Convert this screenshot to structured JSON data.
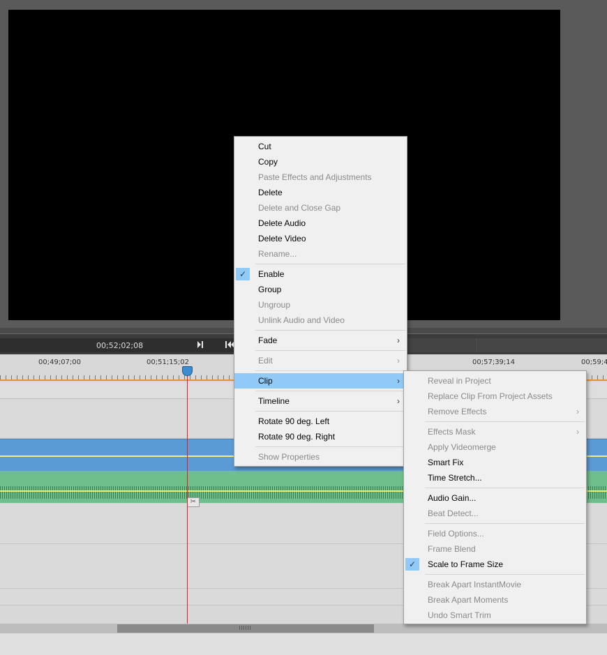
{
  "transport": {
    "timecode": "00;52;02;08"
  },
  "ruler": {
    "labels": [
      "00;49;07;00",
      "00;51;15;02",
      "00;57;39;14",
      "00;59;4"
    ]
  },
  "context_menu": {
    "items": [
      {
        "label": "Cut",
        "enabled": true
      },
      {
        "label": "Copy",
        "enabled": true
      },
      {
        "label": "Paste Effects and Adjustments",
        "enabled": false
      },
      {
        "label": "Delete",
        "enabled": true
      },
      {
        "label": "Delete and Close Gap",
        "enabled": false
      },
      {
        "label": "Delete Audio",
        "enabled": true
      },
      {
        "label": "Delete Video",
        "enabled": true
      },
      {
        "label": "Rename...",
        "enabled": false
      },
      {
        "label": "Enable",
        "enabled": true,
        "checked": true
      },
      {
        "label": "Group",
        "enabled": true
      },
      {
        "label": "Ungroup",
        "enabled": false
      },
      {
        "label": "Unlink Audio and Video",
        "enabled": false
      },
      {
        "label": "Fade",
        "enabled": true,
        "submenu": true
      },
      {
        "label": "Edit",
        "enabled": false,
        "submenu": true
      },
      {
        "label": "Clip",
        "enabled": true,
        "submenu": true,
        "highlighted": true
      },
      {
        "label": "Timeline",
        "enabled": true,
        "submenu": true
      },
      {
        "label": "Rotate 90 deg. Left",
        "enabled": true
      },
      {
        "label": "Rotate 90 deg. Right",
        "enabled": true
      },
      {
        "label": "Show Properties",
        "enabled": false
      }
    ]
  },
  "clip_submenu": {
    "items": [
      {
        "label": "Reveal in Project",
        "enabled": false
      },
      {
        "label": "Replace Clip From Project Assets",
        "enabled": false
      },
      {
        "label": "Remove Effects",
        "enabled": false,
        "submenu": true
      },
      {
        "label": "Effects Mask",
        "enabled": false,
        "submenu": true
      },
      {
        "label": "Apply Videomerge",
        "enabled": false
      },
      {
        "label": "Smart Fix",
        "enabled": true
      },
      {
        "label": "Time Stretch...",
        "enabled": true
      },
      {
        "label": "Audio Gain...",
        "enabled": true
      },
      {
        "label": "Beat Detect...",
        "enabled": false
      },
      {
        "label": "Field Options...",
        "enabled": false
      },
      {
        "label": "Frame Blend",
        "enabled": false
      },
      {
        "label": "Scale to Frame Size",
        "enabled": true,
        "checked": true
      },
      {
        "label": "Break Apart InstantMovie",
        "enabled": false
      },
      {
        "label": "Break Apart Moments",
        "enabled": false
      },
      {
        "label": "Undo Smart Trim",
        "enabled": false
      }
    ]
  },
  "icons": {
    "check": "checkmark-icon",
    "submenu_arrow": "chevron-right-icon",
    "marker": "marker-icon",
    "previous": "skip-back-icon",
    "scissor": "scissor-icon",
    "playhead": "playhead-icon"
  },
  "colors": {
    "highlight": "#91c9f7",
    "video_track": "#5b9bd5",
    "audio_track": "#6fbf8c",
    "playhead": "#e02020",
    "ruler_accent": "#e8902a"
  }
}
